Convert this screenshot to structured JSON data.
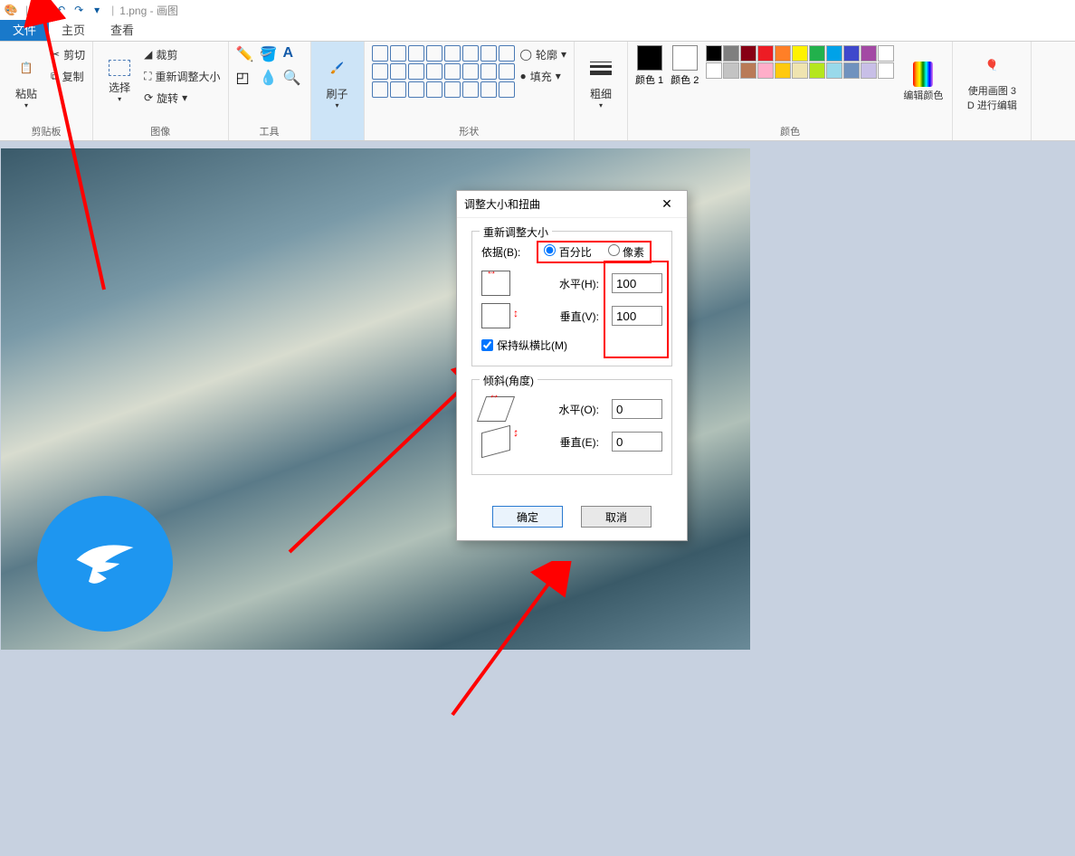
{
  "titlebar": {
    "filename": "1.png",
    "app_suffix": " - 画图"
  },
  "tabs": {
    "file": "文件",
    "home": "主页",
    "view": "查看"
  },
  "ribbon": {
    "clipboard": {
      "paste": "粘贴",
      "cut": "剪切",
      "copy": "复制",
      "label": "剪贴板"
    },
    "image": {
      "select": "选择",
      "crop": "裁剪",
      "resize": "重新调整大小",
      "rotate": "旋转",
      "label": "图像"
    },
    "tools": {
      "label": "工具"
    },
    "brush": {
      "label": "刷子"
    },
    "shapes": {
      "outline": "轮廓",
      "fill": "填充",
      "label": "形状"
    },
    "size": {
      "big": "粗细",
      "label": ""
    },
    "colors": {
      "color1": "颜色 1",
      "color2": "颜色 2",
      "edit": "编辑颜色",
      "label": "颜色"
    },
    "paint3d": {
      "top": "使用画图 3",
      "bottom": "D 进行编辑"
    }
  },
  "palette": [
    "#000000",
    "#7f7f7f",
    "#870014",
    "#ed1c24",
    "#ff7f27",
    "#fff200",
    "#22b14c",
    "#00a2e8",
    "#3f48cc",
    "#a349a4",
    "#ffffff",
    "#ffffff",
    "#c3c3c3",
    "#b97a57",
    "#ffaec9",
    "#ffc90e",
    "#efe4b0",
    "#b5e61d",
    "#99d9ea",
    "#7092be",
    "#c8bfe7",
    "#ffffff"
  ],
  "dialog": {
    "title": "调整大小和扭曲",
    "resize_legend": "重新调整大小",
    "by_label": "依据(B):",
    "percentage": "百分比",
    "pixels": "像素",
    "horizontal_h": "水平(H):",
    "vertical_v": "垂直(V):",
    "h_value": "100",
    "v_value": "100",
    "aspect": "保持纵横比(M)",
    "skew_legend": "倾斜(角度)",
    "horizontal_o": "水平(O):",
    "vertical_e": "垂直(E):",
    "skew_h": "0",
    "skew_v": "0",
    "ok": "确定",
    "cancel": "取消"
  }
}
